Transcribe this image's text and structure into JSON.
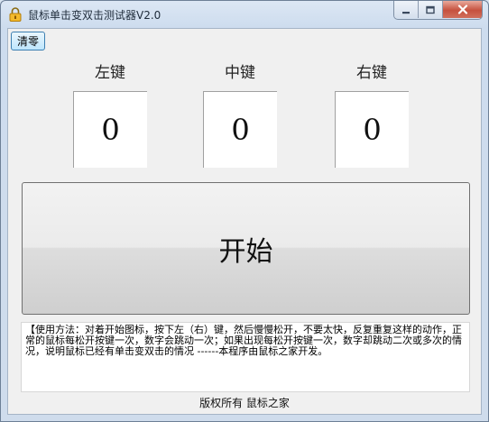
{
  "window": {
    "title": "鼠标单击变双击测试器V2.0"
  },
  "toolbar": {
    "clear_label": "清零"
  },
  "keys": [
    {
      "label": "左键",
      "count": "0"
    },
    {
      "label": "中键",
      "count": "0"
    },
    {
      "label": "右键",
      "count": "0"
    }
  ],
  "start_button": {
    "label": "开始"
  },
  "instructions": {
    "text": "【使用方法：对着开始图标，按下左（右）键，然后慢慢松开，不要太快，反复重复这样的动作，正常的鼠标每松开按键一次，数字会跳动一次；如果出现每松开按键一次，数字却跳动二次或多次的情况，说明鼠标已经有单击变双击的情况 ------本程序由鼠标之家开发。"
  },
  "footer": {
    "text": "版权所有 鼠标之家"
  },
  "icons": {
    "app": "lock-icon",
    "minimize": "minimize-icon",
    "maximize": "maximize-icon",
    "close": "close-icon"
  },
  "colors": {
    "close_button": "#c6513e",
    "client_background": "#f0f0f0",
    "focus_border": "#3c7fb1"
  }
}
